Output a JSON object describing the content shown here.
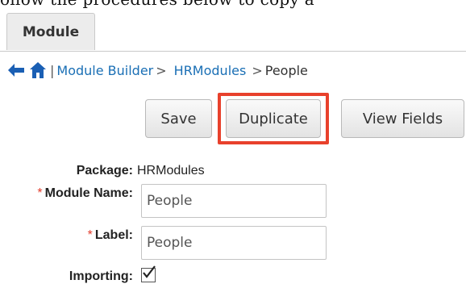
{
  "top_strip_text": "ollow the procedures below to copy a",
  "tabs": [
    {
      "label": "Module"
    }
  ],
  "breadcrumb": {
    "items": [
      {
        "label": "Module Builder"
      },
      {
        "label": "HRModules"
      },
      {
        "label": "People"
      }
    ],
    "separator_pipe": "|",
    "separator_arrow": ">"
  },
  "buttons": {
    "save_label": "Save",
    "duplicate_label": "Duplicate",
    "view_fields_label": "View Fields"
  },
  "form": {
    "package_label": "Package:",
    "package_value": "HRModules",
    "module_name_label": "Module Name:",
    "module_name_value": "People",
    "label_label": "Label:",
    "label_value": "People",
    "importing_label": "Importing:",
    "importing_checked": true,
    "required_marker": "*"
  },
  "colors": {
    "link": "#1a6fb5",
    "highlight": "#e8412c",
    "required": "#e23b2b",
    "back_arrow": "#1a5fb4",
    "home_icon": "#1a5fb4"
  },
  "icons": {
    "back": "left-arrow-icon",
    "home": "home-icon",
    "checkbox": "checkmark-icon"
  }
}
